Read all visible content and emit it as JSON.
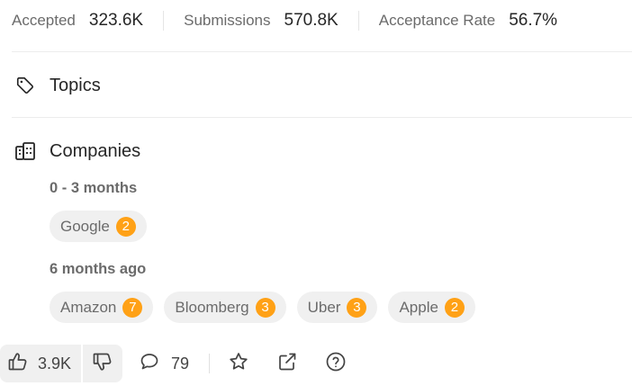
{
  "stats": [
    {
      "label": "Accepted",
      "value": "323.6K"
    },
    {
      "label": "Submissions",
      "value": "570.8K"
    },
    {
      "label": "Acceptance Rate",
      "value": "56.7%"
    }
  ],
  "topics": {
    "title": "Topics",
    "icon": "tag-icon"
  },
  "companies": {
    "title": "Companies",
    "icon": "building-icon",
    "groups": [
      {
        "label": "0 - 3 months",
        "items": [
          {
            "name": "Google",
            "count": "2"
          }
        ]
      },
      {
        "label": "6 months ago",
        "items": [
          {
            "name": "Amazon",
            "count": "7"
          },
          {
            "name": "Bloomberg",
            "count": "3"
          },
          {
            "name": "Uber",
            "count": "3"
          },
          {
            "name": "Apple",
            "count": "2"
          }
        ]
      }
    ]
  },
  "footer": {
    "likes": "3.9K",
    "comments": "79",
    "icons": [
      "thumbs-up-icon",
      "thumbs-down-icon",
      "comment-icon",
      "star-icon",
      "share-icon",
      "help-icon"
    ]
  },
  "colors": {
    "accent": "#ffa116",
    "chip_bg": "#f0f0f0",
    "muted_text": "#6b6b6b"
  }
}
